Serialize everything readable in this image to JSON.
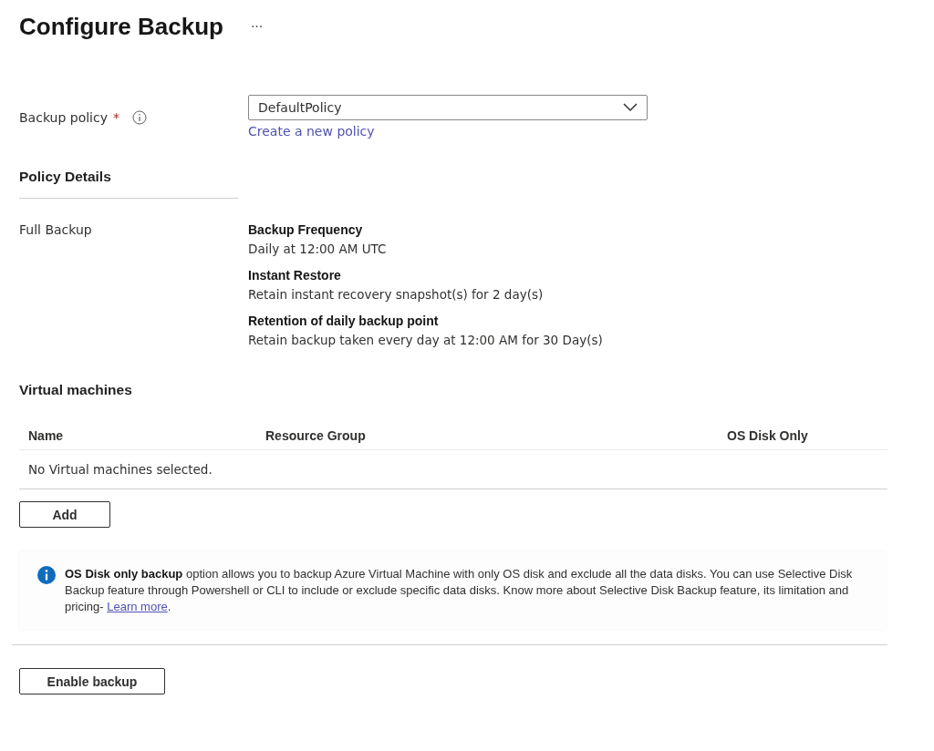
{
  "header": {
    "title": "Configure Backup",
    "more": "···"
  },
  "policy_field": {
    "label": "Backup policy",
    "required": "*",
    "value": "DefaultPolicy",
    "link": "Create a new policy"
  },
  "policy_details": {
    "heading": "Policy Details",
    "label": "Full Backup",
    "items": [
      {
        "title": "Backup Frequency",
        "text": "Daily at 12:00 AM UTC"
      },
      {
        "title": "Instant Restore",
        "text": "Retain instant recovery snapshot(s) for 2 day(s)"
      },
      {
        "title": "Retention of daily backup point",
        "text": "Retain backup taken every day at 12:00 AM for 30 Day(s)"
      }
    ]
  },
  "virtual_machines": {
    "heading": "Virtual machines",
    "columns": [
      "Name",
      "Resource Group",
      "OS Disk Only"
    ],
    "empty_text": "No Virtual machines selected.",
    "add_button": "Add"
  },
  "info": {
    "text": "**OS Disk only backup**  option allows you to backup Azure Virtual Machine with only OS disk and exclude all the data disks. You can use Selective Disk Backup feature through Powershell or CLI to include or exclude specific data disks. Know more about Selective Disk Backup feature, its limitation and pricing- ",
    "link": "Learn more",
    "text_after": "."
  },
  "footer": {
    "button": "Enable backup"
  }
}
